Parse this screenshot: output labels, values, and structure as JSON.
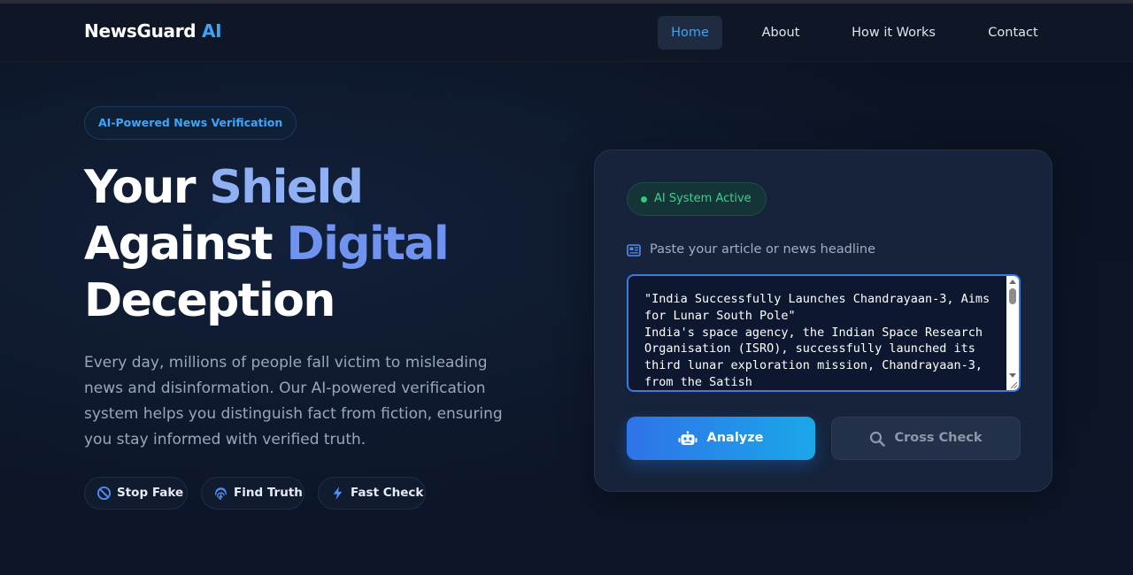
{
  "brand": {
    "name": "NewsGuard",
    "accent": "AI"
  },
  "nav": {
    "home": "Home",
    "about": "About",
    "how": "How it Works",
    "contact": "Contact",
    "active": "Home"
  },
  "hero": {
    "badge": "AI-Powered News Verification",
    "headline": {
      "w1": "Your",
      "w2": "Shield",
      "w3": "Against",
      "w4": "Digital",
      "w5": "Deception"
    },
    "description": "Every day, millions of people fall victim to misleading news and disinformation. Our AI-powered verification system helps you distinguish fact from fiction, ensuring you stay informed with verified truth.",
    "chips": {
      "stop": "Stop Fake",
      "find": "Find Truth",
      "fast": "Fast Check"
    }
  },
  "card": {
    "status": "AI System Active",
    "input_label": "Paste your article or news headline",
    "textarea_value": "\"India Successfully Launches Chandrayaan-3, Aims for Lunar South Pole\"\nIndia's space agency, the Indian Space Research Organisation (ISRO), successfully launched its third lunar exploration mission, Chandrayaan-3, from the Satish",
    "analyze_label": "Analyze",
    "crosscheck_label": "Cross Check"
  },
  "colors": {
    "accent": "#3ea6f7",
    "active_green": "#34c97e",
    "background": "#0c1424",
    "card": "#16233a"
  },
  "icons": {
    "stop": "ban-icon",
    "find": "fingerprint-icon",
    "fast": "lightning-icon",
    "label": "newspaper-icon",
    "analyze": "robot-icon",
    "check": "search-icon"
  }
}
